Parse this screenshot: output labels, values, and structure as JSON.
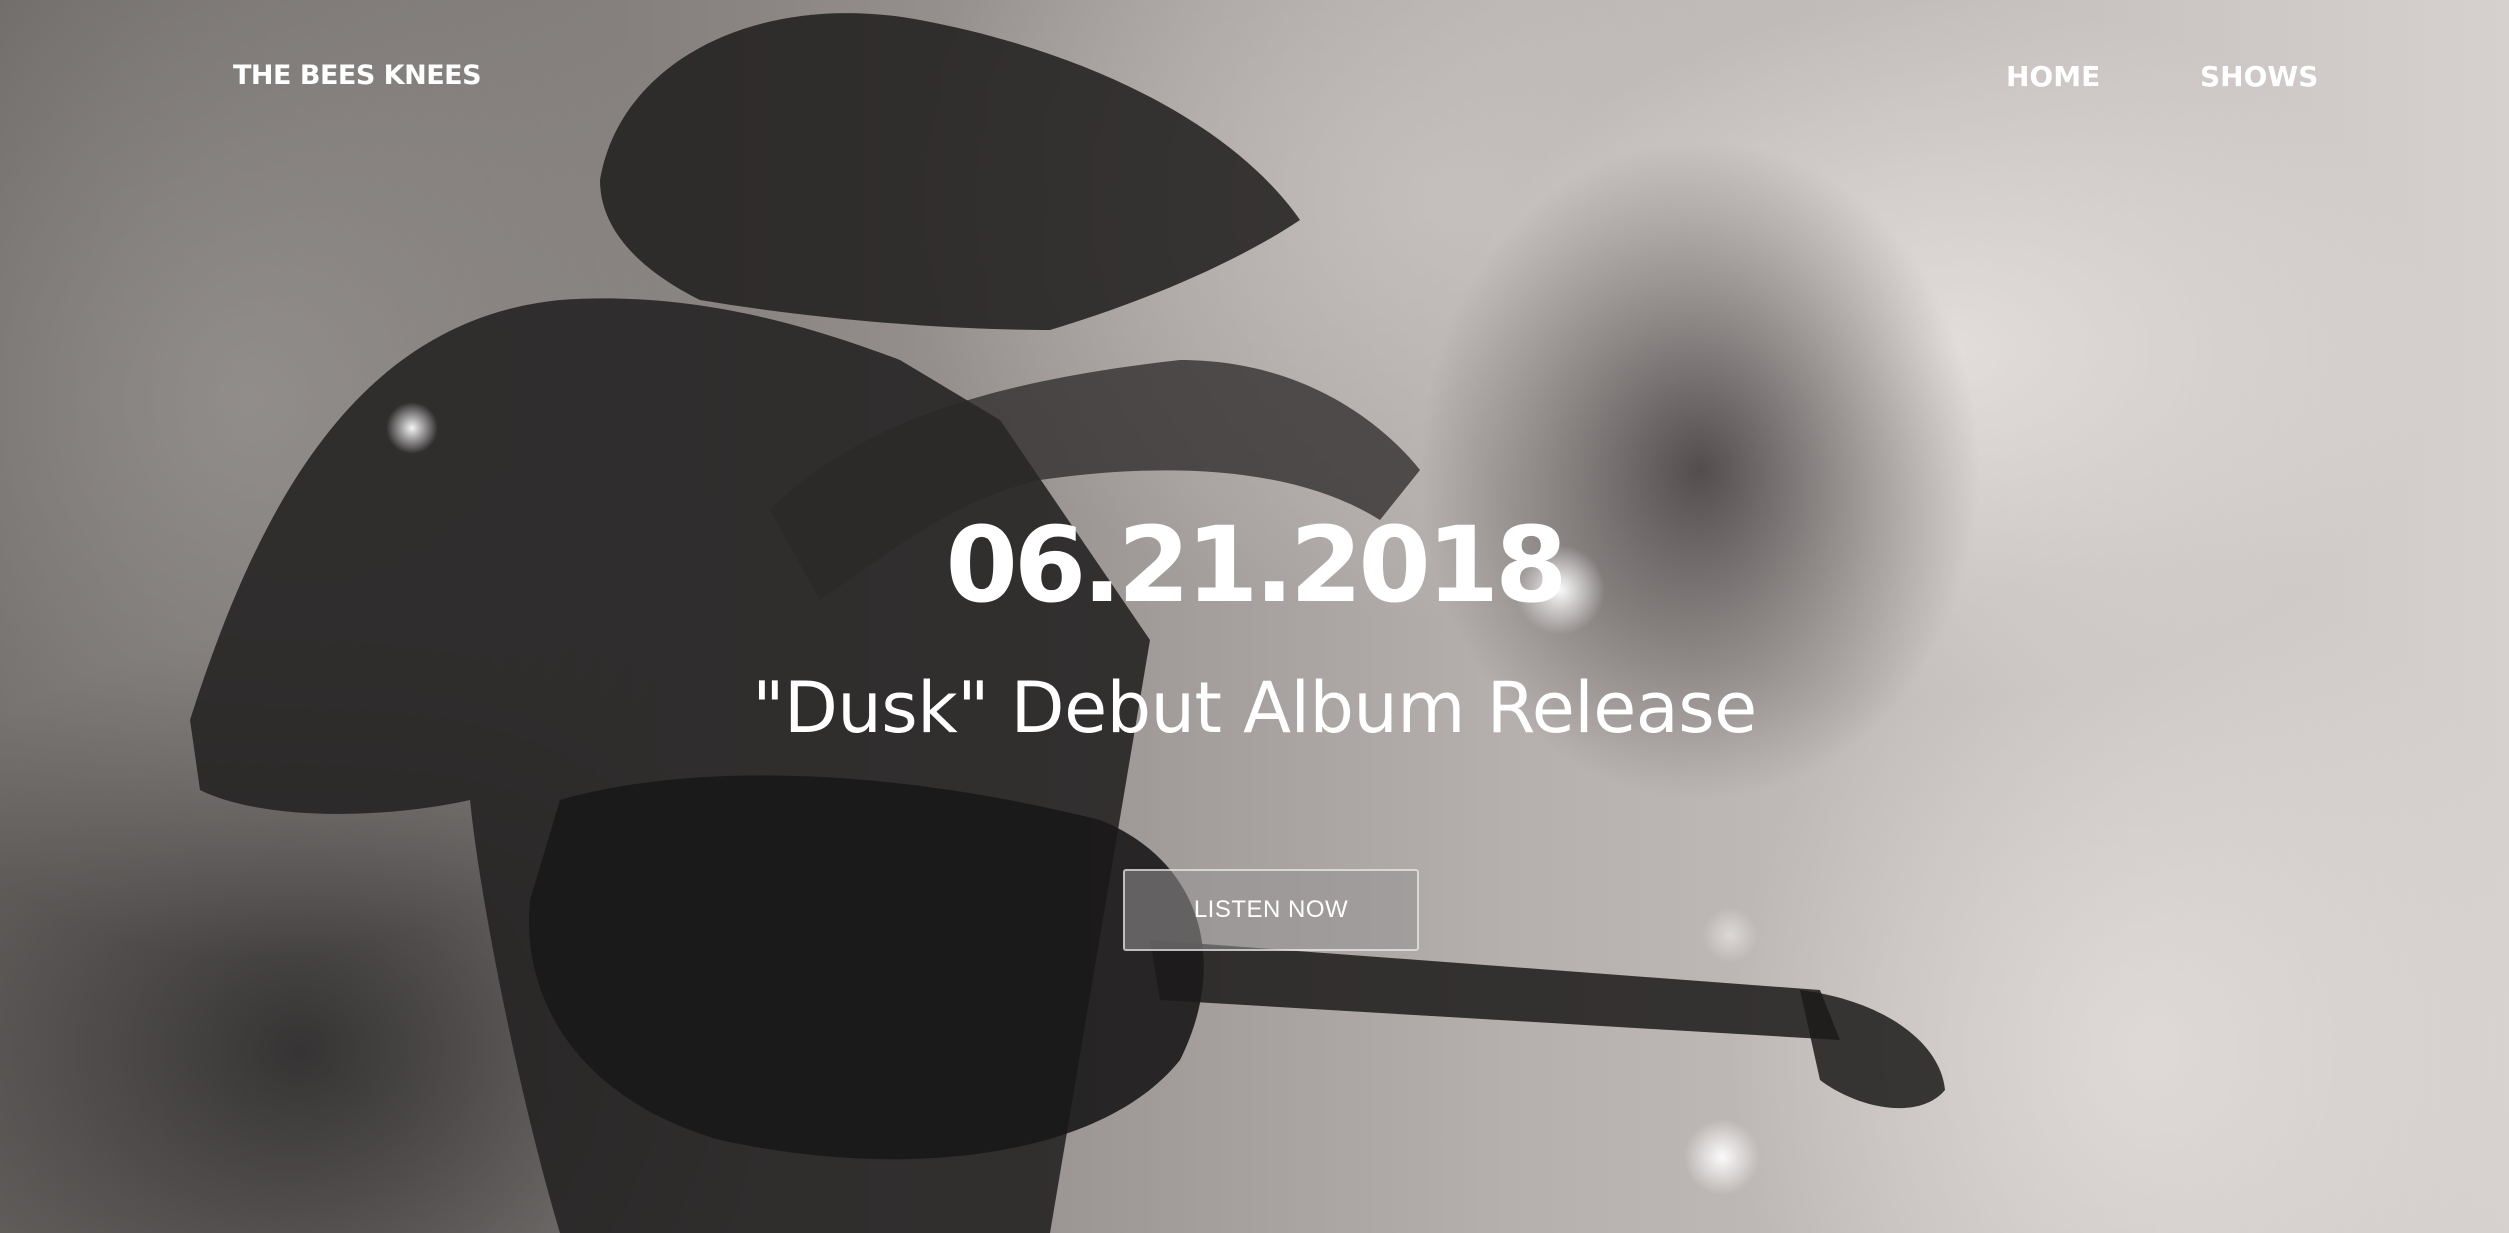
{
  "header": {
    "brand": "THE BEES KNEES",
    "nav": [
      {
        "label": "HOME"
      },
      {
        "label": "SHOWS"
      }
    ]
  },
  "hero": {
    "date": "06.21.2018",
    "subtitle": "\"Dusk\" Debut Album Release",
    "cta_label": "LISTEN NOW",
    "image": "black-and-white double exposure of guitarist performing on stage"
  },
  "colors": {
    "text": "#ffffff",
    "button_bg": "#959393",
    "button_border": "#e6e6e6"
  }
}
